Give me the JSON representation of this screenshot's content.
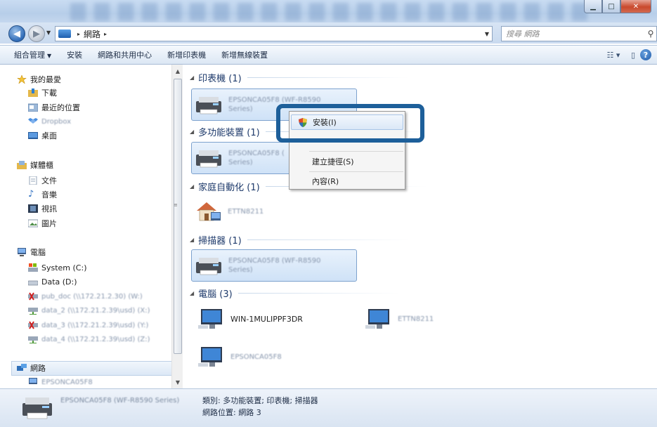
{
  "window": {
    "minimize_icon": "minimize-icon",
    "maximize_icon": "maximize-icon",
    "close_icon": "close-icon"
  },
  "address": {
    "path": "網路",
    "separator": "▸",
    "search_placeholder": "搜尋 網路"
  },
  "toolbar": {
    "organize": "組合管理",
    "install": "安裝",
    "network_center": "網路和共用中心",
    "add_printer": "新增印表機",
    "add_wireless": "新增無線裝置"
  },
  "sidebar": {
    "favorites": {
      "header": "我的最愛",
      "items": [
        "下載",
        "最近的位置",
        "Dropbox",
        "桌面"
      ]
    },
    "libraries": {
      "header": "媒體櫃",
      "items": [
        "文件",
        "音樂",
        "視訊",
        "圖片"
      ]
    },
    "computer": {
      "header": "電腦",
      "drives": [
        "System (C:)",
        "Data (D:)"
      ],
      "network_drives": [
        "pub_doc (\\\\172.21.2.30) (W:)",
        "data_2 (\\\\172.21.2.39\\usd) (X:)",
        "data_3 (\\\\172.21.2.39\\usd) (Y:)",
        "data_4 (\\\\172.21.2.39\\usd) (Z:)"
      ]
    },
    "network": {
      "header": "網路",
      "child": "EPSONCA05F8"
    }
  },
  "content": {
    "groups": {
      "printers": "印表機 (1)",
      "multifunction": "多功能裝置 (1)",
      "home_automation": "家庭自動化 (1)",
      "scanners": "掃描器 (1)",
      "computers": "電腦 (3)"
    },
    "printer_tile": [
      "EPSONCA05F8 (WF-R8590",
      "Series)"
    ],
    "mfd_tile": [
      "EPSONCA05F8 (",
      "Series)"
    ],
    "home_tile": "ETTN8211",
    "scanner_tile": [
      "EPSONCA05F8 (WF-R8590",
      "Series)"
    ],
    "computers": [
      "WIN-1MULIPPF3DR",
      "ETTN8211",
      "EPSONCA05F8"
    ]
  },
  "context_menu": {
    "install": "安裝(I)",
    "create_shortcut": "建立捷徑(S)",
    "properties": "內容(R)"
  },
  "details": {
    "device_name": "EPSONCA05F8 (WF-R8590 Series)",
    "category_label": "類別: 多功能裝置; 印表機; 掃描器",
    "location_label": "網路位置: 網路 3"
  },
  "colors": {
    "callout_border": "#1d5f9a",
    "selection": "#cfe2f7"
  }
}
